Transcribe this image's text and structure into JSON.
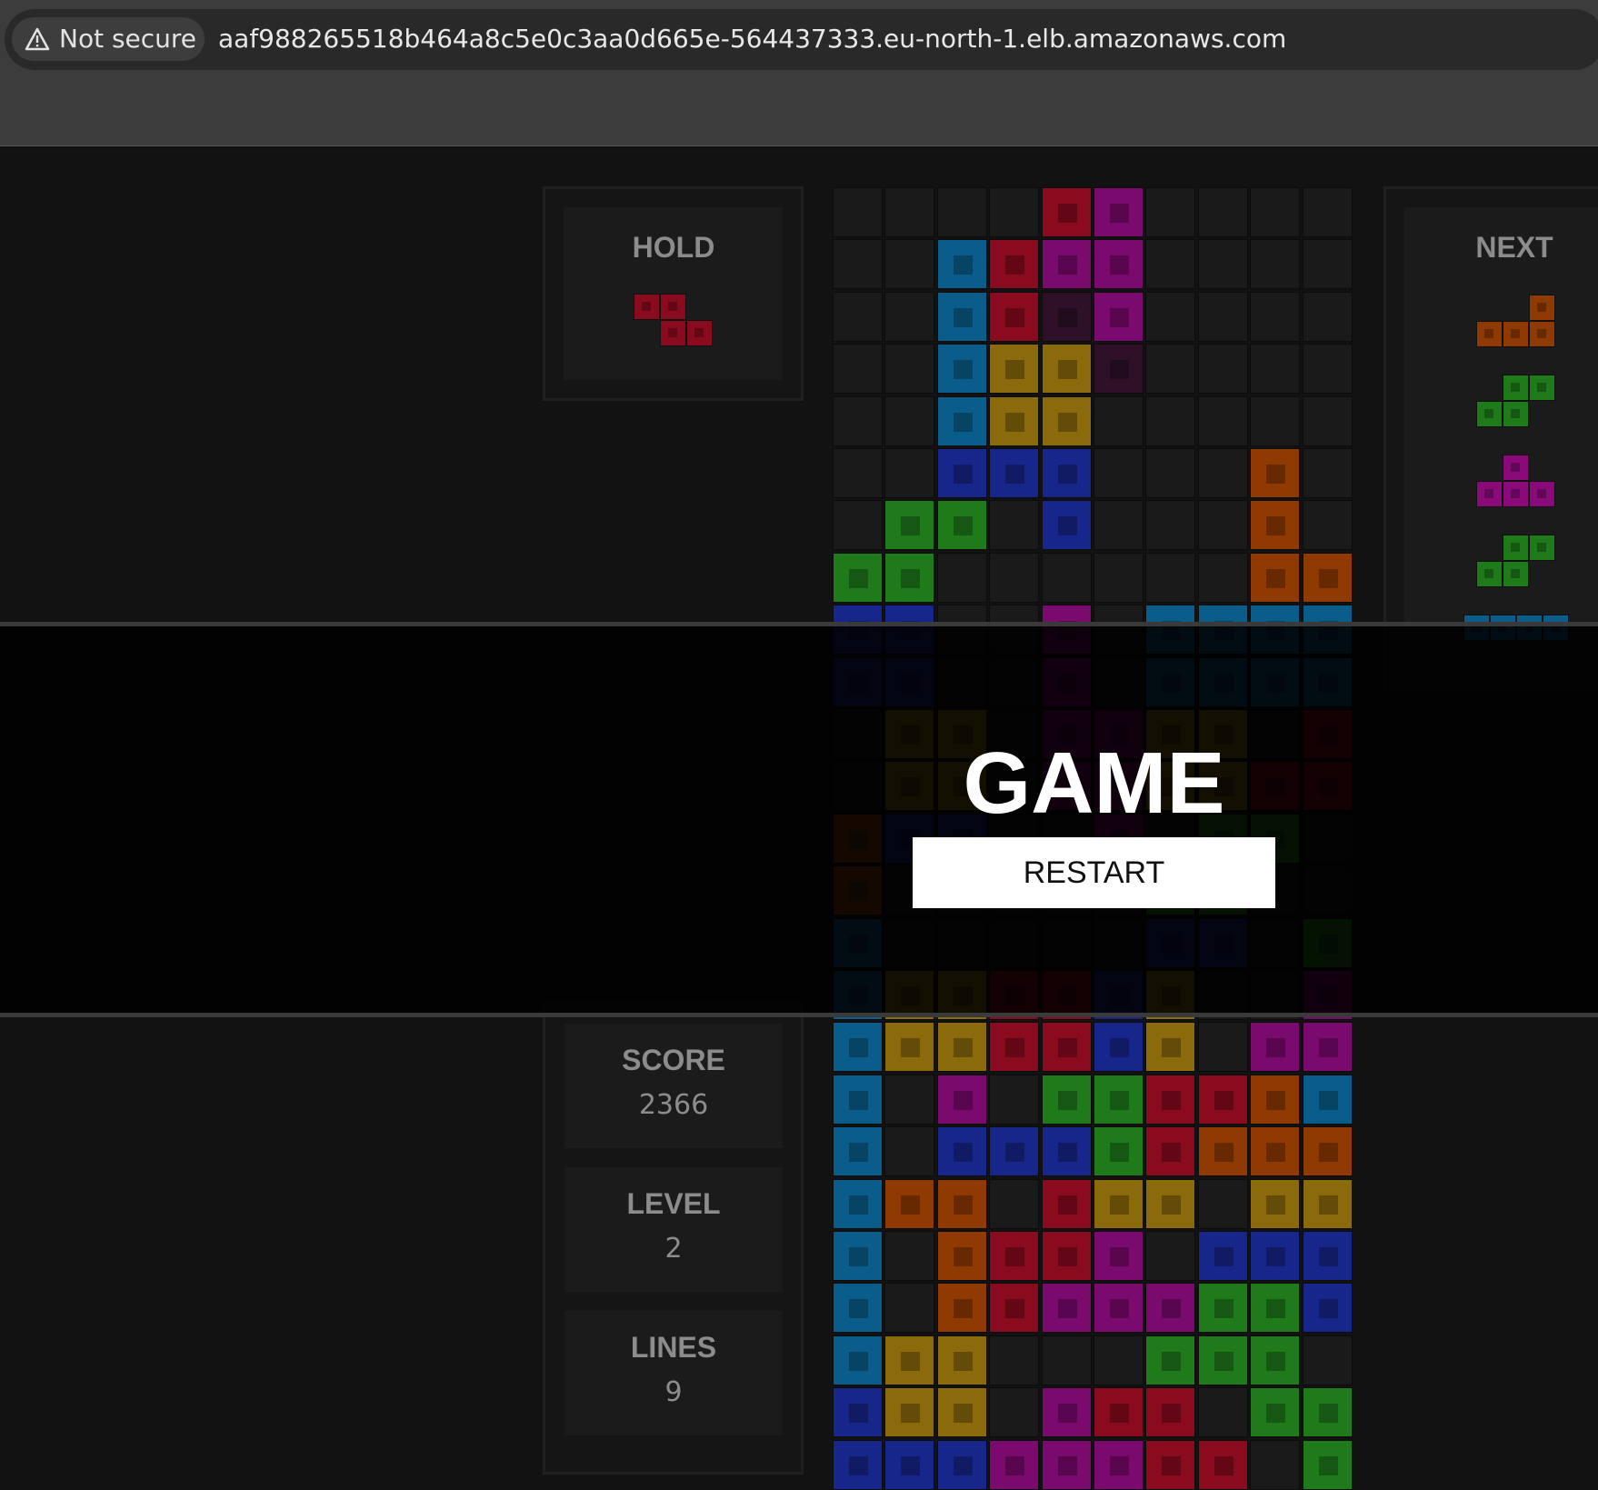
{
  "browser": {
    "security_label": "Not secure",
    "url": "aaf988265518b464a8c5e0c3aa0d665e-564437333.eu-north-1.elb.amazonaws.com"
  },
  "hold": {
    "title": "HOLD",
    "piece": "Z",
    "color": "#8a0a1e"
  },
  "next": {
    "title": "NEXT",
    "pieces": [
      {
        "piece": "L",
        "color": "#8f3a00"
      },
      {
        "piece": "S",
        "color": "#1f7a1a"
      },
      {
        "piece": "T",
        "color": "#8a0a7a"
      },
      {
        "piece": "S",
        "color": "#1f7a1a"
      },
      {
        "piece": "I",
        "color": "#0a5d8a"
      }
    ]
  },
  "stats": {
    "score_label": "SCORE",
    "score_value": "2366",
    "level_label": "LEVEL",
    "level_value": "2",
    "lines_label": "LINES",
    "lines_value": "9"
  },
  "overlay": {
    "title": "GAME OVER",
    "restart_label": "RESTART"
  },
  "colors": {
    "C": "#0a5d8a",
    "R": "#8a0a1e",
    "M": "#7a0a6e",
    "Y": "#8a6a0a",
    "B": "#16268a",
    "G": "#1f7a1a",
    "O": "#8f3a00",
    "P": "#2e1028"
  },
  "board": [
    "....RM....",
    "..CRMM....",
    "..CRPM....",
    "..CYYP....",
    "..CYY.....",
    "..BBB...O.",
    ".GG.B...O.",
    "GG......OO",
    "BB..M.CCCC",
    "BB..M.CCCC",
    ".YY.MMYY.R",
    ".YY.MMYYRR",
    "OBB..M.GG.",
    "O.....GG..",
    "C.....BB.G",
    "CYYRRBY..M",
    "CYYRRBY.MM",
    "C.M.GGRROC",
    "C.BBBGROOO",
    "COO.RYY.YY",
    "C.ORRM.BBB",
    "C.ORMMMGGB",
    "CYY...GGG.",
    "BYY.MRR.GG",
    "BBBMMMRR.G"
  ]
}
